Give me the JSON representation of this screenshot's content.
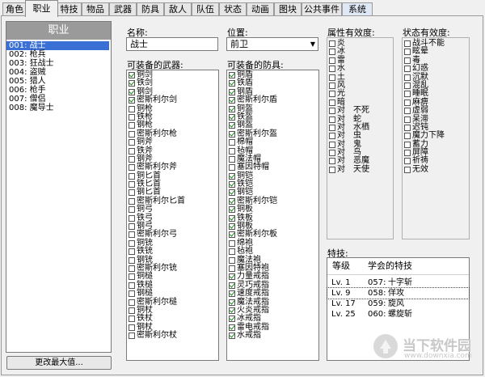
{
  "tabs": [
    "角色",
    "职业",
    "特技",
    "物品",
    "武器",
    "防具",
    "敌人",
    "队伍",
    "状态",
    "动画",
    "图块",
    "公共事件",
    "系统"
  ],
  "active_tab": 1,
  "class_list": {
    "header": "职业",
    "items": [
      "001: 战士",
      "002: 枪兵",
      "003: 狂战士",
      "004: 盗贼",
      "005: 猎人",
      "006: 枪手",
      "007: 僧侣",
      "008: 魔导士"
    ],
    "selected_index": 0,
    "change_max_button": "更改最大值..."
  },
  "name": {
    "label": "名称:",
    "value": "战士"
  },
  "position": {
    "label": "位置:",
    "value": "前卫"
  },
  "weapons": {
    "label": "可装备的武器:",
    "items": [
      {
        "t": "铜剑",
        "c": true
      },
      {
        "t": "铁剑",
        "c": true
      },
      {
        "t": "钢剑",
        "c": true
      },
      {
        "t": "密斯利尔剑",
        "c": true
      },
      {
        "t": "铜枪",
        "c": false
      },
      {
        "t": "铁枪",
        "c": false
      },
      {
        "t": "钢枪",
        "c": false
      },
      {
        "t": "密斯利尔枪",
        "c": false
      },
      {
        "t": "铜斧",
        "c": false
      },
      {
        "t": "铁斧",
        "c": false
      },
      {
        "t": "钢斧",
        "c": false
      },
      {
        "t": "密斯利尔斧",
        "c": false
      },
      {
        "t": "铜匕首",
        "c": false
      },
      {
        "t": "铁匕首",
        "c": false
      },
      {
        "t": "钢匕首",
        "c": false
      },
      {
        "t": "密斯利尔匕首",
        "c": false
      },
      {
        "t": "铜弓",
        "c": false
      },
      {
        "t": "铁弓",
        "c": false
      },
      {
        "t": "钢弓",
        "c": false
      },
      {
        "t": "密斯利尔弓",
        "c": false
      },
      {
        "t": "铜铳",
        "c": false
      },
      {
        "t": "铁铳",
        "c": false
      },
      {
        "t": "钢铳",
        "c": false
      },
      {
        "t": "密斯利尔铳",
        "c": false
      },
      {
        "t": "铜槌",
        "c": false
      },
      {
        "t": "铁槌",
        "c": false
      },
      {
        "t": "钢槌",
        "c": false
      },
      {
        "t": "密斯利尔槌",
        "c": false
      },
      {
        "t": "铜杖",
        "c": false
      },
      {
        "t": "铁杖",
        "c": false
      },
      {
        "t": "钢杖",
        "c": false
      },
      {
        "t": "密斯利尔杖",
        "c": false
      }
    ]
  },
  "armors": {
    "label": "可装备的防具:",
    "items": [
      {
        "t": "铜盾",
        "c": true
      },
      {
        "t": "铁盾",
        "c": true
      },
      {
        "t": "钢盾",
        "c": true
      },
      {
        "t": "密斯利尔盾",
        "c": true
      },
      {
        "t": "铜盔",
        "c": true
      },
      {
        "t": "铁盔",
        "c": true
      },
      {
        "t": "钢盔",
        "c": true
      },
      {
        "t": "密斯利尔盔",
        "c": true
      },
      {
        "t": "棉帽",
        "c": false
      },
      {
        "t": "毡帽",
        "c": false
      },
      {
        "t": "魔法帽",
        "c": false
      },
      {
        "t": "塞因特帽",
        "c": false
      },
      {
        "t": "铜铠",
        "c": true
      },
      {
        "t": "铁铠",
        "c": true
      },
      {
        "t": "钢铠",
        "c": true
      },
      {
        "t": "密斯利尔铠",
        "c": true
      },
      {
        "t": "铜板",
        "c": true
      },
      {
        "t": "铁板",
        "c": true
      },
      {
        "t": "钢板",
        "c": true
      },
      {
        "t": "密斯利尔板",
        "c": true
      },
      {
        "t": "绵袍",
        "c": false
      },
      {
        "t": "毡袍",
        "c": false
      },
      {
        "t": "魔法袍",
        "c": false
      },
      {
        "t": "塞因特袍",
        "c": false
      },
      {
        "t": "力量戒指",
        "c": true
      },
      {
        "t": "灵巧戒指",
        "c": true
      },
      {
        "t": "速度戒指",
        "c": true
      },
      {
        "t": "魔法戒指",
        "c": true
      },
      {
        "t": "火炎戒指",
        "c": true
      },
      {
        "t": "冰戒指",
        "c": true
      },
      {
        "t": "雷电戒指",
        "c": true
      },
      {
        "t": "水戒指",
        "c": true
      }
    ]
  },
  "elements": {
    "label": "属性有效度:",
    "items": [
      "炎",
      "冰",
      "雷",
      "水",
      "土",
      "风",
      "光",
      "暗",
      "对　不死",
      "对　蛇",
      "对　水栖",
      "对　虫",
      "对　鬼",
      "对　鸟",
      "对　恶魔",
      "对　天使"
    ]
  },
  "states": {
    "label": "状态有效度:",
    "items": [
      "战斗不能",
      "眩晕",
      "毒",
      "幻惑",
      "沉默",
      "混乱",
      "睡眠",
      "麻痹",
      "虚弱",
      "呆滞",
      "迟钝",
      "魔力下降",
      "蓄力",
      "屏障",
      "祈祷",
      "无效"
    ]
  },
  "skills": {
    "label": "特技:",
    "col_level": "等级",
    "col_skill": "学会的特技",
    "rows": [
      {
        "lv": "Lv.  1",
        "id": "057:",
        "name": "十字斩"
      },
      {
        "lv": "Lv.  9",
        "id": "058:",
        "name": "佯攻"
      },
      {
        "lv": "Lv. 17",
        "id": "059:",
        "name": "旋风"
      },
      {
        "lv": "Lv. 25",
        "id": "060:",
        "name": "螺旋斩"
      }
    ],
    "selected_index": 1
  },
  "watermark": {
    "text": "当下软件园",
    "url_text": "www.downxia.com"
  },
  "colors": {
    "selection": "#3a70d6",
    "check": "#1c8a1c",
    "list_header": "#9a9a9a"
  }
}
